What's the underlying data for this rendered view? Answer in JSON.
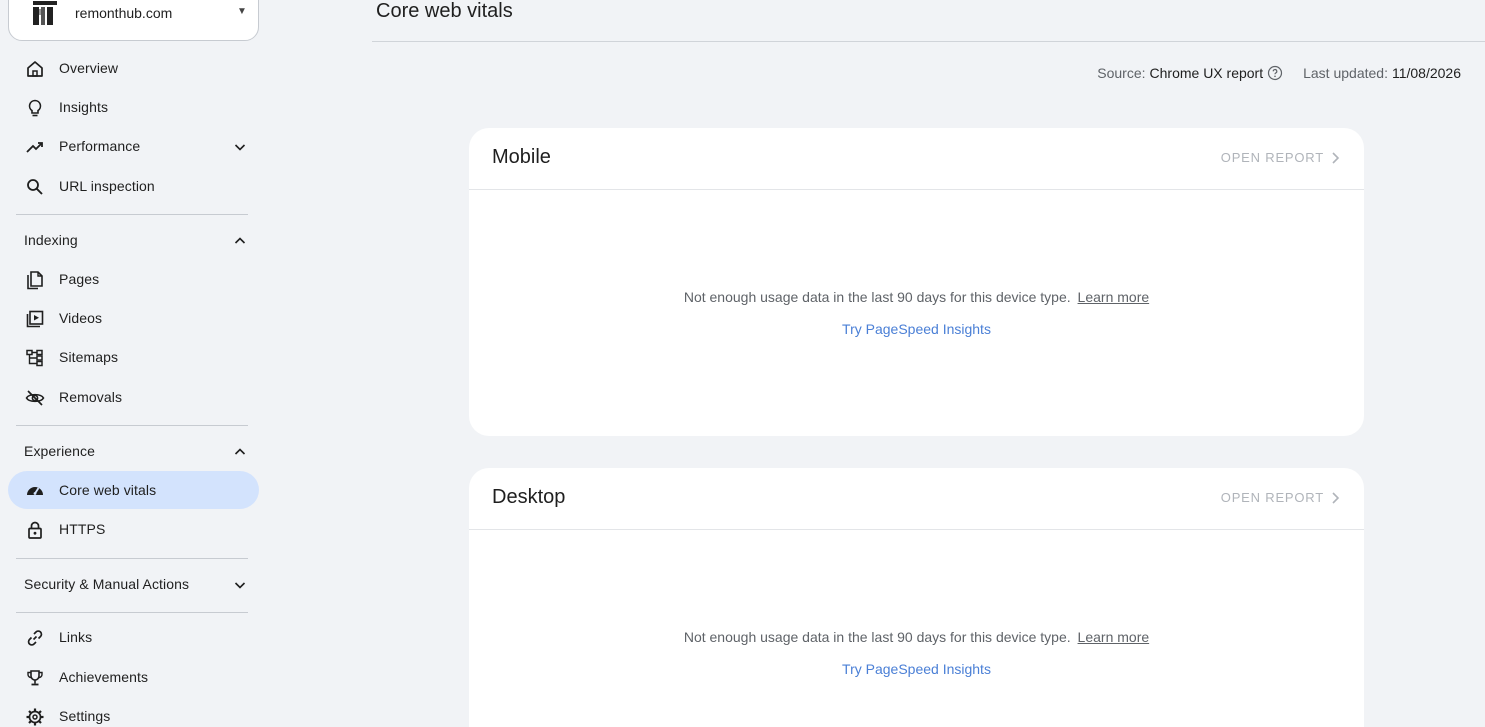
{
  "property": {
    "name": "remonthub.com"
  },
  "nav": {
    "overview": "Overview",
    "insights": "Insights",
    "performance": "Performance",
    "url_inspection": "URL inspection",
    "indexing": {
      "header": "Indexing",
      "pages": "Pages",
      "videos": "Videos",
      "sitemaps": "Sitemaps",
      "removals": "Removals"
    },
    "experience": {
      "header": "Experience",
      "core_web_vitals": "Core web vitals",
      "https": "HTTPS"
    },
    "security": "Security & Manual Actions",
    "links": "Links",
    "achievements": "Achievements",
    "settings": "Settings"
  },
  "header": {
    "title": "Core web vitals",
    "source_label": "Source:",
    "source_value": "Chrome UX report",
    "updated_label": "Last updated:",
    "updated_value": "11/08/2026"
  },
  "cards": {
    "mobile": {
      "title": "Mobile",
      "open_report": "OPEN REPORT",
      "message": "Not enough usage data in the last 90 days for this device type.",
      "learn_more": "Learn more",
      "psi_link": "Try PageSpeed Insights"
    },
    "desktop": {
      "title": "Desktop",
      "open_report": "OPEN REPORT",
      "message": "Not enough usage data in the last 90 days for this device type.",
      "learn_more": "Learn more",
      "psi_link": "Try PageSpeed Insights"
    }
  },
  "colors": {
    "active_bg": "#d3e3fd",
    "link_blue": "#4a7fd6",
    "page_bg": "#f1f3f6"
  }
}
